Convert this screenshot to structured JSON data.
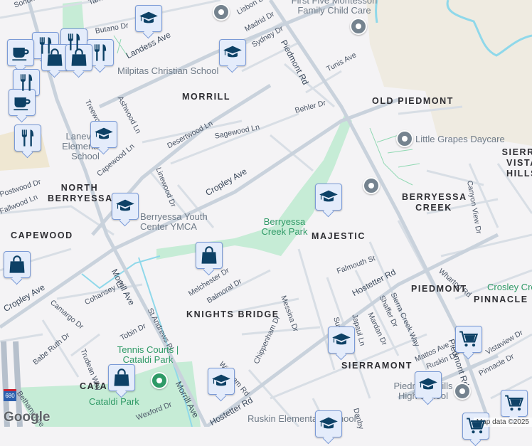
{
  "colors": {
    "background": "#f4f3f5",
    "road": "#d3dae2",
    "major_road": "#c9d2dc",
    "park": "#c6ecd6",
    "water": "#8fd8ea",
    "land": "#efebe1",
    "marker_icon": "#0d4166"
  },
  "streets": [
    "Sonoma Dr",
    "Tahoe Dr",
    "Lisbon Dr",
    "Madrid Dr",
    "Sydney Dr",
    "Butano Dr",
    "Landess Ave",
    "Piedmont Rd",
    "Tunis Ave",
    "Behler Dr",
    "Treewood Ln",
    "Ashwood Ln",
    "Desertwood Ln",
    "Sagewood Ln",
    "Capewood Ln",
    "Linewood Dr",
    "Cropley Ave",
    "Postwood Dr",
    "Fallwood Ln",
    "Canyon View Dr",
    "Morrill Ave",
    "Cropley Ave",
    "Cohansey Dr",
    "Camargo Dr",
    "Melchester Dr",
    "Balmoral Dr",
    "St Andrews Pl",
    "Tobin Dr",
    "Babe Ruth Dr",
    "Trudean Way",
    "Bethany Ave",
    "Wexford Dr",
    "Morrill Ave",
    "Wickham Rd",
    "Chippenham Dr",
    "Hostetter Rd",
    "Messina Dr",
    "Falmouth St",
    "Hostetter Rd",
    "Shaffer Dr",
    "Sierra Creek Way",
    "Japaul Ln",
    "Mardan Dr",
    "Sun Ln",
    "Wharton Rd",
    "Mattos Ave",
    "Ruskin Dr",
    "Piedmont Rd",
    "Vistaview Dr",
    "Pinnacle Dr",
    "Danby"
  ],
  "neighborhoods": [
    "MORRILL",
    "OLD PIEDMONT",
    "SIERRA VISTA HILLS",
    "NORTH BERRYESSA",
    "BERRYESSA CREEK",
    "CAPEWOOD",
    "MAJESTIC",
    "KNIGHTS BRIDGE",
    "PIEDMONT",
    "PINNACLE",
    "SIERRAMONT",
    "CATALDI"
  ],
  "pois": [
    "First Five Montessori Family Child Care",
    "Milpitas Christian School",
    "Little Grapes Daycare",
    "Laneview Elementary School",
    "Berryessa Youth Center YMCA",
    "Piedmont Hills High School",
    "Ruskin Elementary School"
  ],
  "parks": [
    "Berryessa Creek Park",
    "Tennis Courts | Cataldi Park",
    "Cataldi Park",
    "Crosley Creek"
  ],
  "highway_shield": "680",
  "attribution": "Map data ©2025",
  "logo": "Google"
}
